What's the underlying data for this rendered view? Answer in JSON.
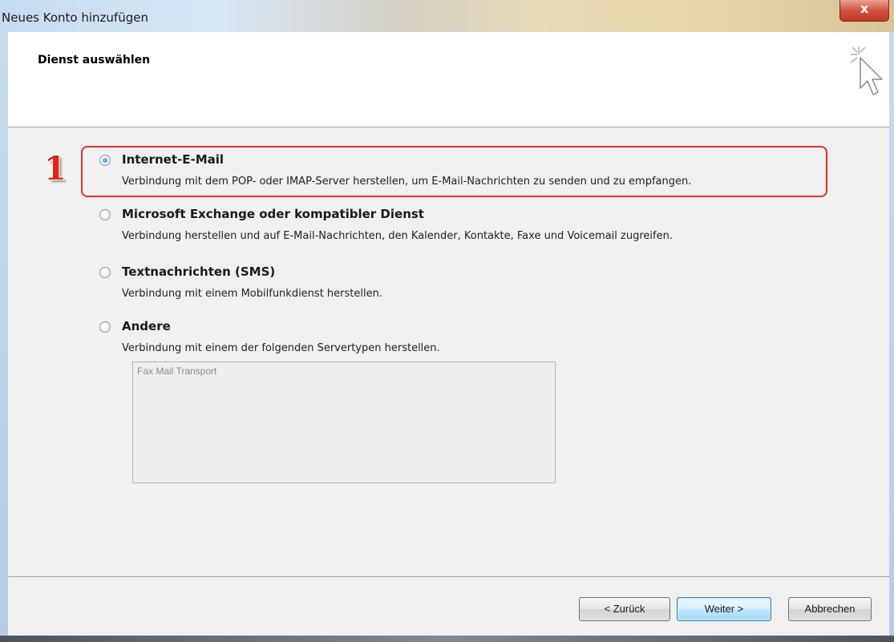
{
  "window": {
    "title": "Neues Konto hinzufügen",
    "close_glyph": "x"
  },
  "header": {
    "title": "Dienst auswählen",
    "icon": "wizard-cursor-icon"
  },
  "annotation": {
    "step_number": "1",
    "highlight_color": "#e0302a"
  },
  "options": [
    {
      "label": "Internet-E-Mail",
      "description": "Verbindung mit dem POP- oder IMAP-Server herstellen, um E-Mail-Nachrichten zu senden und zu empfangen.",
      "selected": true
    },
    {
      "label": "Microsoft Exchange oder kompatibler Dienst",
      "description": "Verbindung herstellen und auf E-Mail-Nachrichten, den Kalender, Kontakte, Faxe und Voicemail zugreifen.",
      "selected": false
    },
    {
      "label": "Textnachrichten (SMS)",
      "description": "Verbindung mit einem Mobilfunkdienst herstellen.",
      "selected": false
    },
    {
      "label": "Andere",
      "description": "Verbindung mit einem der folgenden Servertypen herstellen.",
      "selected": false
    }
  ],
  "server_types": {
    "items": [
      "Fax Mail Transport"
    ]
  },
  "buttons": {
    "back": "< Zurück",
    "next": "Weiter >",
    "cancel": "Abbrechen"
  }
}
